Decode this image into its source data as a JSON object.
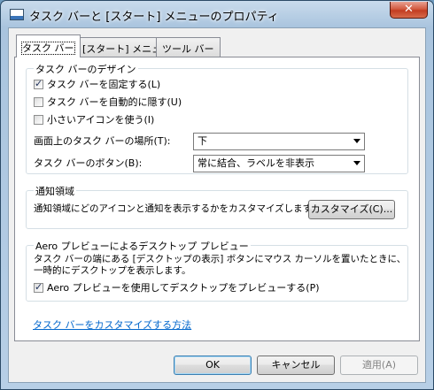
{
  "window": {
    "title": "タスク バーと [スタート] メニューのプロパティ",
    "close_glyph": "✕"
  },
  "tabs": [
    {
      "label": "タスク バー",
      "active": true
    },
    {
      "label": "[スタート] メニュー",
      "active": false
    },
    {
      "label": "ツール バー",
      "active": false
    }
  ],
  "design_group": {
    "title": "タスク バーのデザイン",
    "checkboxes": [
      {
        "label": "タスク バーを固定する(L)",
        "checked": true
      },
      {
        "label": "タスク バーを自動的に隠す(U)",
        "checked": false
      },
      {
        "label": "小さいアイコンを使う(I)",
        "checked": false
      }
    ],
    "location_label": "画面上のタスク バーの場所(T):",
    "location_value": "下",
    "buttons_label": "タスク バーのボタン(B):",
    "buttons_value": "常に結合、ラベルを非表示"
  },
  "notify_group": {
    "title": "通知領域",
    "description": "通知領域にどのアイコンと通知を表示するかをカスタマイズします。",
    "customize_button": "カスタマイズ(C)..."
  },
  "aero_group": {
    "title": "Aero プレビューによるデスクトップ プレビュー",
    "description_line1": "タスク バーの端にある [デスクトップの表示] ボタンにマウス カーソルを置いたときに、",
    "description_line2": "一時的にデスクトップを表示します。",
    "checkbox_label": "Aero プレビューを使用してデスクトップをプレビューする(P)",
    "checked": true
  },
  "help_link": "タスク バーをカスタマイズする方法",
  "footer": {
    "ok": "OK",
    "cancel": "キャンセル",
    "apply": "適用(A)"
  }
}
